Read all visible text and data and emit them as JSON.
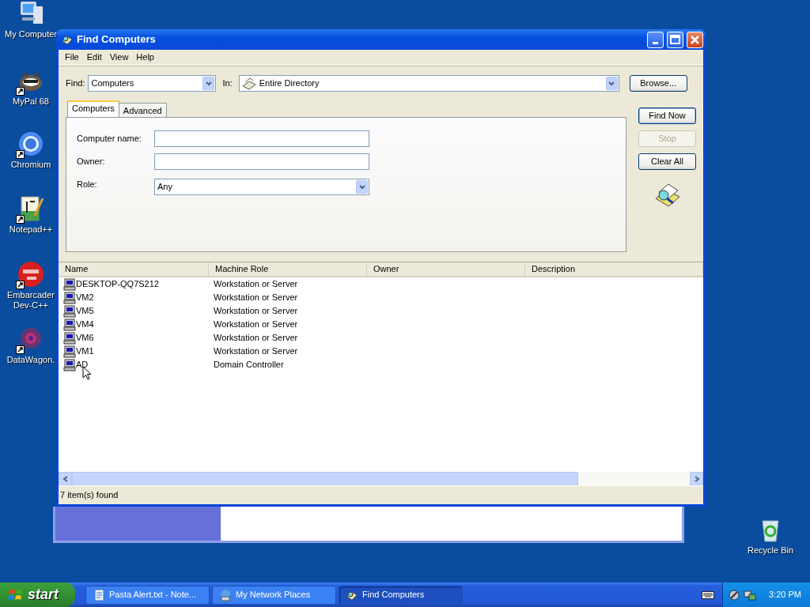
{
  "desktop": {
    "icons": [
      {
        "label": "My Computer",
        "kind": "computer",
        "shortcut": false
      },
      {
        "label": "MyPal 68",
        "kind": "raccoon",
        "shortcut": true
      },
      {
        "label": "Chromium",
        "kind": "browser",
        "shortcut": true
      },
      {
        "label": "Notepad++",
        "kind": "notepad",
        "shortcut": true
      },
      {
        "label": "Embarcader Dev-C++",
        "kind": "devcpp",
        "shortcut": true
      },
      {
        "label": "DataWagon.",
        "kind": "datawagon",
        "shortcut": true
      }
    ],
    "recycle_bin": "Recycle Bin"
  },
  "window": {
    "title": "Find Computers",
    "menu": [
      "File",
      "Edit",
      "View",
      "Help"
    ],
    "find_label": "Find:",
    "find_value": "Computers",
    "in_label": "In:",
    "in_value": "Entire Directory",
    "browse": "Browse...",
    "tabs": [
      {
        "label": "Computers",
        "selected": true
      },
      {
        "label": "Advanced",
        "selected": false
      }
    ],
    "fields": [
      {
        "label": "Computer name:",
        "kind": "text"
      },
      {
        "label": "Owner:",
        "kind": "text"
      },
      {
        "label": "Role:",
        "kind": "dropdown",
        "value": "Any"
      }
    ],
    "buttons": [
      {
        "label": "Find Now",
        "disabled": false
      },
      {
        "label": "Stop",
        "disabled": true
      },
      {
        "label": "Clear All",
        "disabled": false
      }
    ],
    "columns": [
      "Name",
      "Machine Role",
      "Owner",
      "Description"
    ],
    "rows": [
      {
        "name": "DESKTOP-QQ7S212",
        "role": "Workstation or Server"
      },
      {
        "name": "VM2",
        "role": "Workstation or Server"
      },
      {
        "name": "VM5",
        "role": "Workstation or Server"
      },
      {
        "name": "VM4",
        "role": "Workstation or Server"
      },
      {
        "name": "VM6",
        "role": "Workstation or Server"
      },
      {
        "name": "VM1",
        "role": "Workstation or Server"
      },
      {
        "name": "AD",
        "role": "Domain Controller"
      }
    ],
    "status": "7 item(s) found"
  },
  "taskbar": {
    "start": "start",
    "tasks": [
      {
        "label": "Pasta Alert.txt - Note...",
        "kind": "notepad",
        "selected": false
      },
      {
        "label": "My Network Places",
        "kind": "network",
        "selected": false
      },
      {
        "label": "Find Computers",
        "kind": "find",
        "selected": true
      }
    ],
    "clock": "3:20 PM"
  }
}
